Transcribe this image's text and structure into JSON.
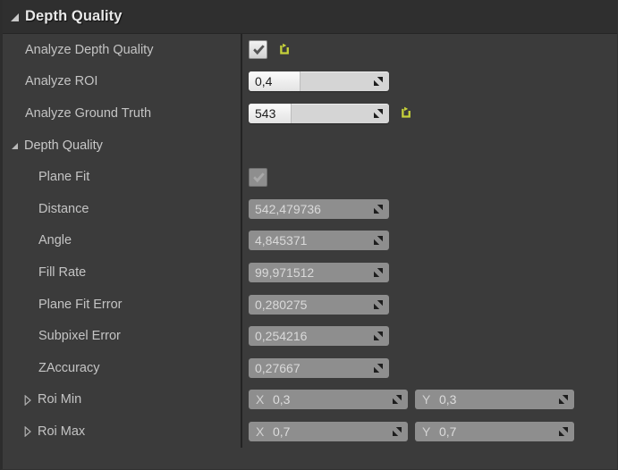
{
  "panel": {
    "category": {
      "title": "Depth Quality",
      "expanded": true,
      "collapse_icon": "triangle-down-icon"
    },
    "accent_colors": {
      "panel_bg": "#3b3b3b",
      "header_bg": "#2f2f2f",
      "label_text": "#c4c4c4",
      "revert_icon": "#c6d13a",
      "editable_field_bg": "#e3e3e3",
      "readonly_field_bg": "#8e8e8e",
      "splitter": "#232323"
    },
    "rows": [
      {
        "name": "analyze-depth-quality",
        "label": "Analyze Depth Quality",
        "indent": 1,
        "control": "checkbox",
        "checked": true,
        "enabled": true,
        "revert": true,
        "icons": {
          "check": "check-icon",
          "revert": "revert-arrow-icon"
        }
      },
      {
        "name": "analyze-roi",
        "label": "Analyze ROI",
        "indent": 1,
        "control": "slider",
        "value": "0,4",
        "fill_percent": 36,
        "revert": false,
        "icons": {
          "drag": "drag-handle-icon"
        }
      },
      {
        "name": "analyze-ground-truth",
        "label": "Analyze Ground Truth",
        "indent": 1,
        "control": "slider",
        "value": "543",
        "fill_percent": 30,
        "revert": true,
        "icons": {
          "drag": "drag-handle-icon",
          "revert": "revert-arrow-icon"
        }
      },
      {
        "name": "depth-quality-group",
        "label": "Depth Quality",
        "indent": 1,
        "control": "group",
        "expanded": true,
        "icons": {
          "collapse": "triangle-down-icon"
        }
      },
      {
        "name": "plane-fit",
        "label": "Plane Fit",
        "indent": 2,
        "control": "checkbox",
        "checked": true,
        "enabled": false,
        "revert": false,
        "icons": {
          "check": "check-icon"
        }
      },
      {
        "name": "distance",
        "label": "Distance",
        "indent": 2,
        "control": "readonly",
        "value": "542,479736",
        "icons": {
          "drag": "drag-handle-icon"
        }
      },
      {
        "name": "angle",
        "label": "Angle",
        "indent": 2,
        "control": "readonly",
        "value": "4,845371",
        "icons": {
          "drag": "drag-handle-icon"
        }
      },
      {
        "name": "fill-rate",
        "label": "Fill Rate",
        "indent": 2,
        "control": "readonly",
        "value": "99,971512",
        "icons": {
          "drag": "drag-handle-icon"
        }
      },
      {
        "name": "plane-fit-error",
        "label": "Plane Fit Error",
        "indent": 2,
        "control": "readonly",
        "value": "0,280275",
        "icons": {
          "drag": "drag-handle-icon"
        }
      },
      {
        "name": "subpixel-error",
        "label": "Subpixel Error",
        "indent": 2,
        "control": "readonly",
        "value": "0,254216",
        "icons": {
          "drag": "drag-handle-icon"
        }
      },
      {
        "name": "zaccuracy",
        "label": "ZAccuracy",
        "indent": 2,
        "control": "readonly",
        "value": "0,27667",
        "icons": {
          "drag": "drag-handle-icon"
        }
      },
      {
        "name": "roi-min",
        "label": "Roi Min",
        "indent": 2,
        "control": "vector2",
        "expanded": false,
        "axes": [
          {
            "axis": "X",
            "value": "0,3"
          },
          {
            "axis": "Y",
            "value": "0,3"
          }
        ],
        "icons": {
          "expand": "triangle-right-icon",
          "drag": "drag-handle-icon"
        }
      },
      {
        "name": "roi-max",
        "label": "Roi Max",
        "indent": 2,
        "control": "vector2",
        "expanded": false,
        "axes": [
          {
            "axis": "X",
            "value": "0,7"
          },
          {
            "axis": "Y",
            "value": "0,7"
          }
        ],
        "icons": {
          "expand": "triangle-right-icon",
          "drag": "drag-handle-icon"
        }
      }
    ]
  }
}
